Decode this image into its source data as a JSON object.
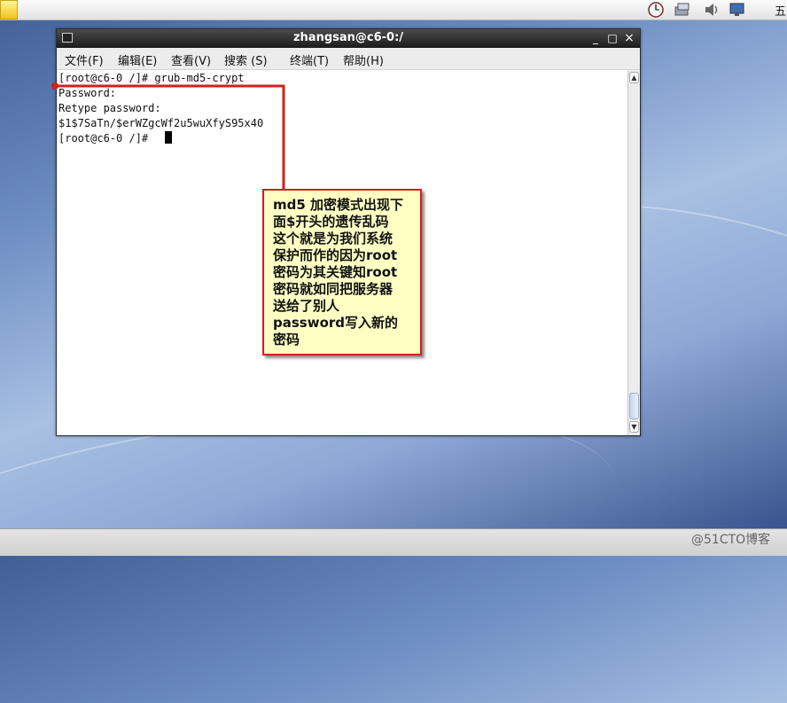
{
  "panel": {
    "clock_text": "五"
  },
  "window": {
    "title": "zhangsan@c6-0:/",
    "controls": [
      "_",
      "□",
      "×"
    ]
  },
  "menu": [
    "文件(F)",
    "编辑(E)",
    "查看(V)",
    "搜索 (S)",
    "终端(T)",
    "帮助(H)"
  ],
  "terminal": {
    "lines": [
      "[root@c6-0 /]# grub-md5-crypt",
      "Password:",
      "Retype password:",
      "$1$7SaTn/$erWZgcWf2u5wuXfyS95x40",
      "[root@c6-0 /]# "
    ]
  },
  "annotation": {
    "text": "md5 加密模式出现下\n面$开头的遗传乱码\n这个就是为我们系统\n保护而作的因为root\n密码为其关键知root\n密码就如同把服务器\n送给了别人\npassword写入新的\n密码",
    "border_color": "#d21f1f",
    "fill_color": "#ffffc4"
  },
  "scrollbar": {
    "up_arrow": "▲",
    "down_arrow": "▼"
  },
  "watermark": "@51CTO博客"
}
